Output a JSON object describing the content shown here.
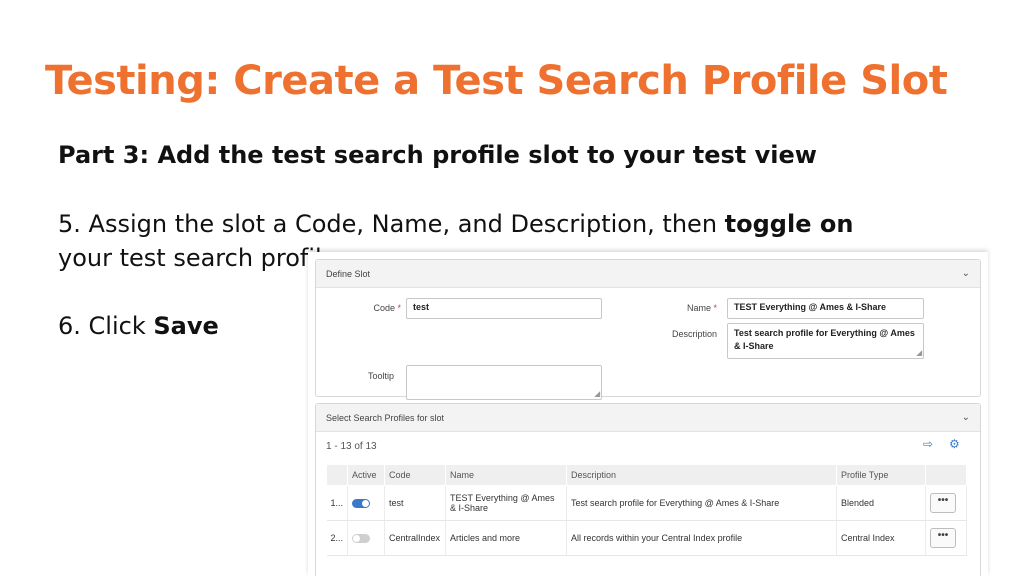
{
  "slide": {
    "title": "Testing: Create a Test Search Profile Slot",
    "part_heading": "Part 3: Add the test search profile slot to your test view",
    "step5_prefix": "5. Assign the slot a Code, Name, and Description, then ",
    "step5_bold": "toggle on",
    "step5_line2": "your test search profile",
    "step6_prefix": "6. Click ",
    "step6_bold": "Save"
  },
  "define_slot": {
    "header": "Define Slot",
    "code_label": "Code",
    "code_value": "test",
    "name_label": "Name",
    "name_value": "TEST Everything @ Ames & I-Share",
    "description_label": "Description",
    "description_value": "Test search profile for Everything @ Ames & I-Share",
    "tooltip_label": "Tooltip",
    "tooltip_value": ""
  },
  "select_profiles": {
    "header": "Select Search Profiles for slot",
    "count": "1 - 13 of 13",
    "columns": [
      "Active",
      "Code",
      "Name",
      "Description",
      "Profile Type"
    ],
    "rows": [
      {
        "num": "1...",
        "active": true,
        "code": "test",
        "name": "TEST Everything @ Ames & I-Share",
        "description": "Test search profile for Everything @ Ames & I-Share",
        "type": "Blended",
        "menu": "•••"
      },
      {
        "num": "2...",
        "active": false,
        "code": "CentralIndex",
        "name": "Articles and more",
        "description": "All records within your Central Index profile",
        "type": "Central Index",
        "menu": "•••"
      }
    ]
  },
  "colors": {
    "title": "#ee7130",
    "toggle_on": "#3a78c8",
    "toggle_off": "#cfcfcf"
  },
  "icons": [
    "chevron-down-icon",
    "export-icon",
    "settings-icon",
    "more-actions-icon",
    "resize-grip-icon"
  ]
}
